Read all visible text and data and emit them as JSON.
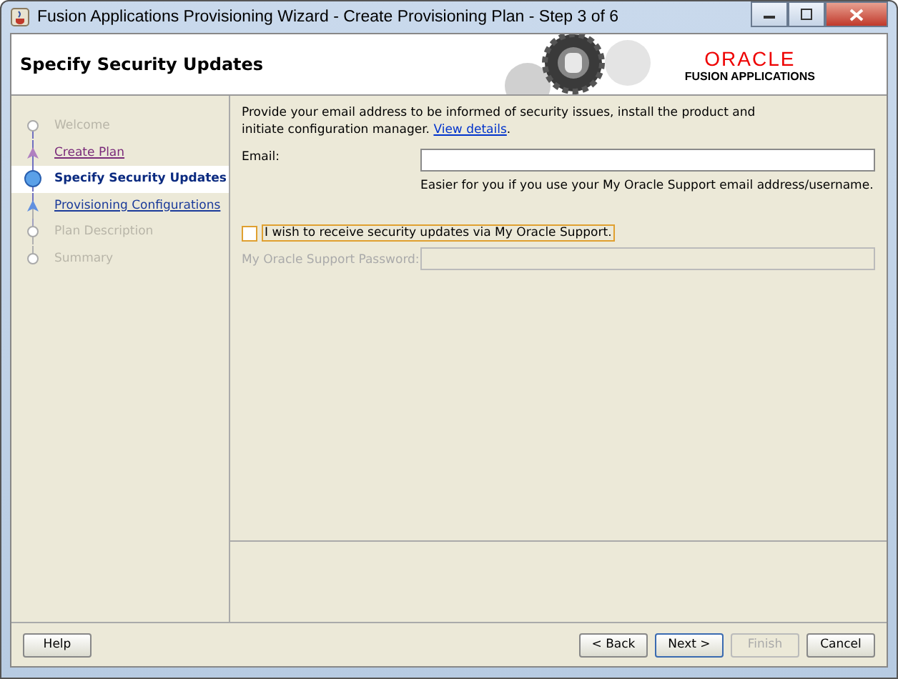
{
  "window": {
    "title": "Fusion Applications Provisioning Wizard - Create Provisioning Plan - Step 3 of 6"
  },
  "header": {
    "title": "Specify Security Updates",
    "logo": "ORACLE",
    "logo_subtitle": "FUSION APPLICATIONS"
  },
  "steps": [
    {
      "label": "Welcome",
      "kind": "disabled",
      "selected": false
    },
    {
      "label": "Create Plan",
      "kind": "visited",
      "selected": false
    },
    {
      "label": "Specify Security Updates",
      "kind": "current",
      "selected": true
    },
    {
      "label": "Provisioning Configurations",
      "kind": "link",
      "selected": false
    },
    {
      "label": "Plan Description",
      "kind": "disabled",
      "selected": false
    },
    {
      "label": "Summary",
      "kind": "disabled",
      "selected": false
    }
  ],
  "intro": {
    "text": "Provide your email address to be informed of security issues, install the product and initiate configuration manager.",
    "link": "View details",
    "after": "."
  },
  "email": {
    "label": "Email:",
    "hint": "Easier for you if you use your My Oracle Support email address/username."
  },
  "updates_checkbox": {
    "label": "I wish to receive security updates via My Oracle Support.",
    "checked": false
  },
  "password": {
    "label": "My Oracle Support Password:",
    "disabled": true
  },
  "buttons": [
    {
      "label": "Help",
      "disabled": false,
      "default": false
    },
    {
      "label": "< Back",
      "disabled": false,
      "default": false
    },
    {
      "label": "Next >",
      "disabled": false,
      "default": true
    },
    {
      "label": "Finish",
      "disabled": true,
      "default": false
    },
    {
      "label": "Cancel",
      "disabled": false,
      "default": false
    }
  ]
}
